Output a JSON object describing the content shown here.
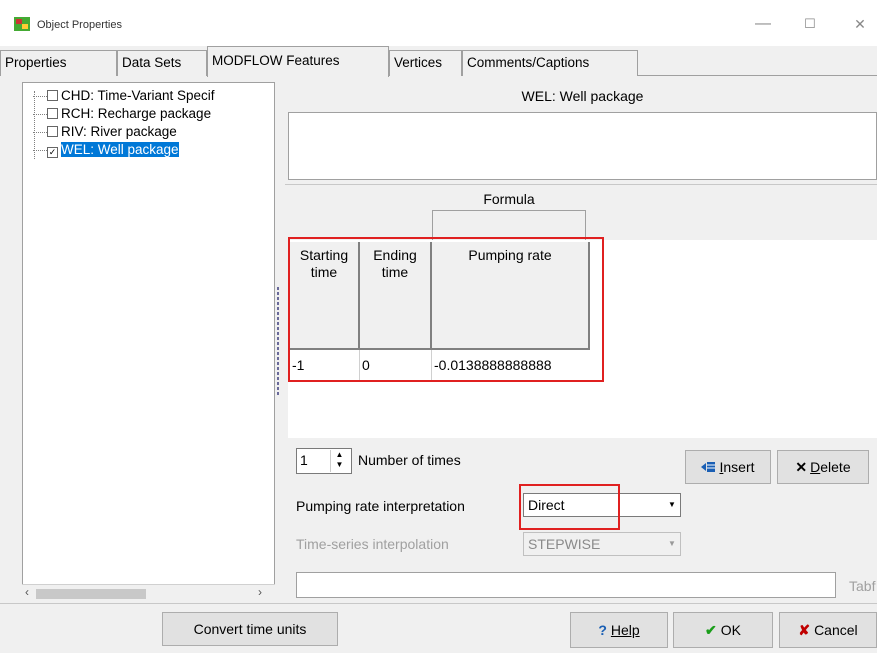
{
  "window": {
    "title": "Object Properties",
    "minimize": "—",
    "maximize": "☐",
    "close": "✕"
  },
  "tabs": [
    {
      "label": "Properties",
      "active": false
    },
    {
      "label": "Data Sets",
      "active": false
    },
    {
      "label": "MODFLOW Features",
      "active": true
    },
    {
      "label": "Vertices",
      "active": false
    },
    {
      "label": "Comments/Captions",
      "active": false
    }
  ],
  "tree": {
    "items": [
      {
        "label": "CHD: Time-Variant Specif",
        "checked": false,
        "check_glyph": ""
      },
      {
        "label": "RCH: Recharge package",
        "checked": false,
        "check_glyph": ""
      },
      {
        "label": "RIV: River package",
        "checked": false,
        "check_glyph": ""
      },
      {
        "label": "WEL: Well package",
        "checked": true,
        "check_glyph": "✓",
        "selected": true
      }
    ],
    "scroll_left": "‹",
    "scroll_right": "›"
  },
  "panel": {
    "header": "WEL: Well package",
    "formula_label": "Formula"
  },
  "grid": {
    "columns": [
      "Starting time",
      "Ending time",
      "Pumping rate"
    ],
    "rows": [
      [
        "-1",
        "0",
        "-0.0138888888888"
      ]
    ]
  },
  "controls": {
    "number_of_times_value": "1",
    "number_of_times_label": "Number of times",
    "insert_label": "Insert",
    "delete_label": "Delete",
    "pumping_rate_interpretation_label": "Pumping rate interpretation",
    "pumping_rate_interpretation_value": "Direct",
    "time_series_interpolation_label": "Time-series interpolation",
    "time_series_interpolation_value": "STEPWISE",
    "tab_label_partial": "Tabf"
  },
  "footer": {
    "convert_label": "Convert time units",
    "help_label": "Help",
    "ok_label": "OK",
    "cancel_label": "Cancel"
  },
  "colors": {
    "highlight": "#e02020",
    "selection": "#0078d7",
    "ok_check": "#1a9e1a",
    "cancel_x": "#c00000",
    "help_q": "#1a5fb4"
  }
}
